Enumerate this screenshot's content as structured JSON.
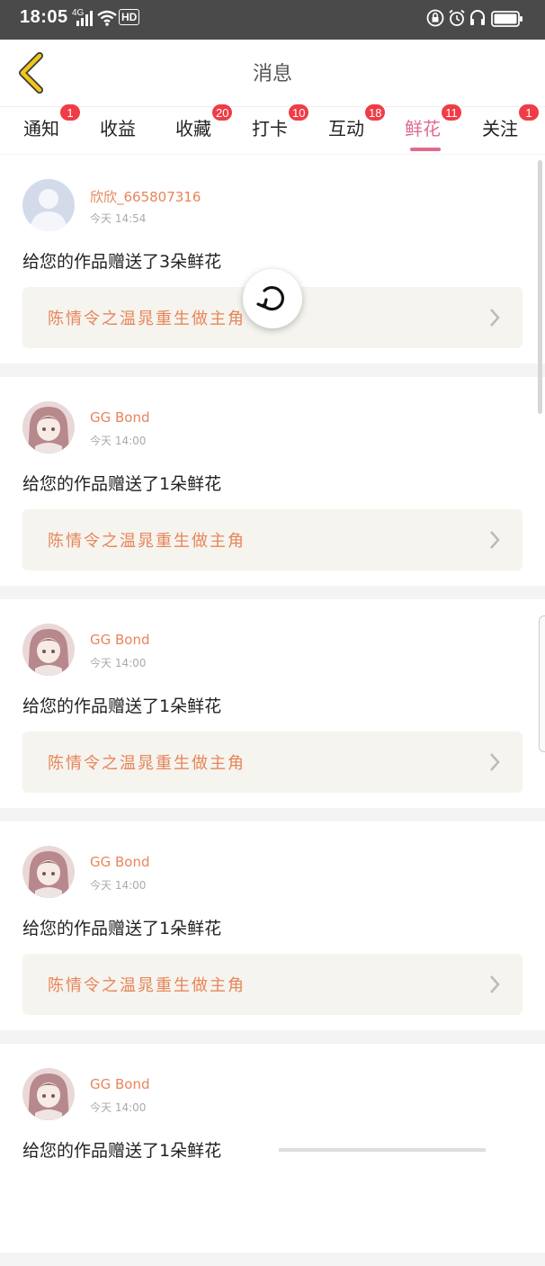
{
  "status": {
    "time": "18:05",
    "net": "4G",
    "hd": "HD"
  },
  "nav": {
    "title": "消息"
  },
  "tabs": [
    {
      "label": "通知",
      "badge": "1"
    },
    {
      "label": "收益",
      "badge": ""
    },
    {
      "label": "收藏",
      "badge": "20"
    },
    {
      "label": "打卡",
      "badge": "10"
    },
    {
      "label": "互动",
      "badge": "18"
    },
    {
      "label": "鲜花",
      "badge": "11",
      "active": true
    },
    {
      "label": "关注",
      "badge": "1"
    }
  ],
  "messages": [
    {
      "user": "欣欣_665807316",
      "time": "今天 14:54",
      "text": "给您的作品赠送了3朵鲜花",
      "work": "陈情令之温晁重生做主角",
      "avatar": "default-avatar-icon"
    },
    {
      "user": "GG Bond",
      "time": "今天 14:00",
      "text": "给您的作品赠送了1朵鲜花",
      "work": "陈情令之温晁重生做主角",
      "avatar": "anime-girl-avatar"
    },
    {
      "user": "GG Bond",
      "time": "今天 14:00",
      "text": "给您的作品赠送了1朵鲜花",
      "work": "陈情令之温晁重生做主角",
      "avatar": "anime-girl-avatar"
    },
    {
      "user": "GG Bond",
      "time": "今天 14:00",
      "text": "给您的作品赠送了1朵鲜花",
      "work": "陈情令之温晁重生做主角",
      "avatar": "anime-girl-avatar"
    },
    {
      "user": "GG Bond",
      "time": "今天 14:00",
      "text": "给您的作品赠送了1朵鲜花",
      "work": "",
      "avatar": "anime-girl-avatar"
    }
  ],
  "colors": {
    "accent": "#e06a8b",
    "username": "#e8855a",
    "badge": "#f03c45",
    "back_arrow": "#f2c618"
  }
}
